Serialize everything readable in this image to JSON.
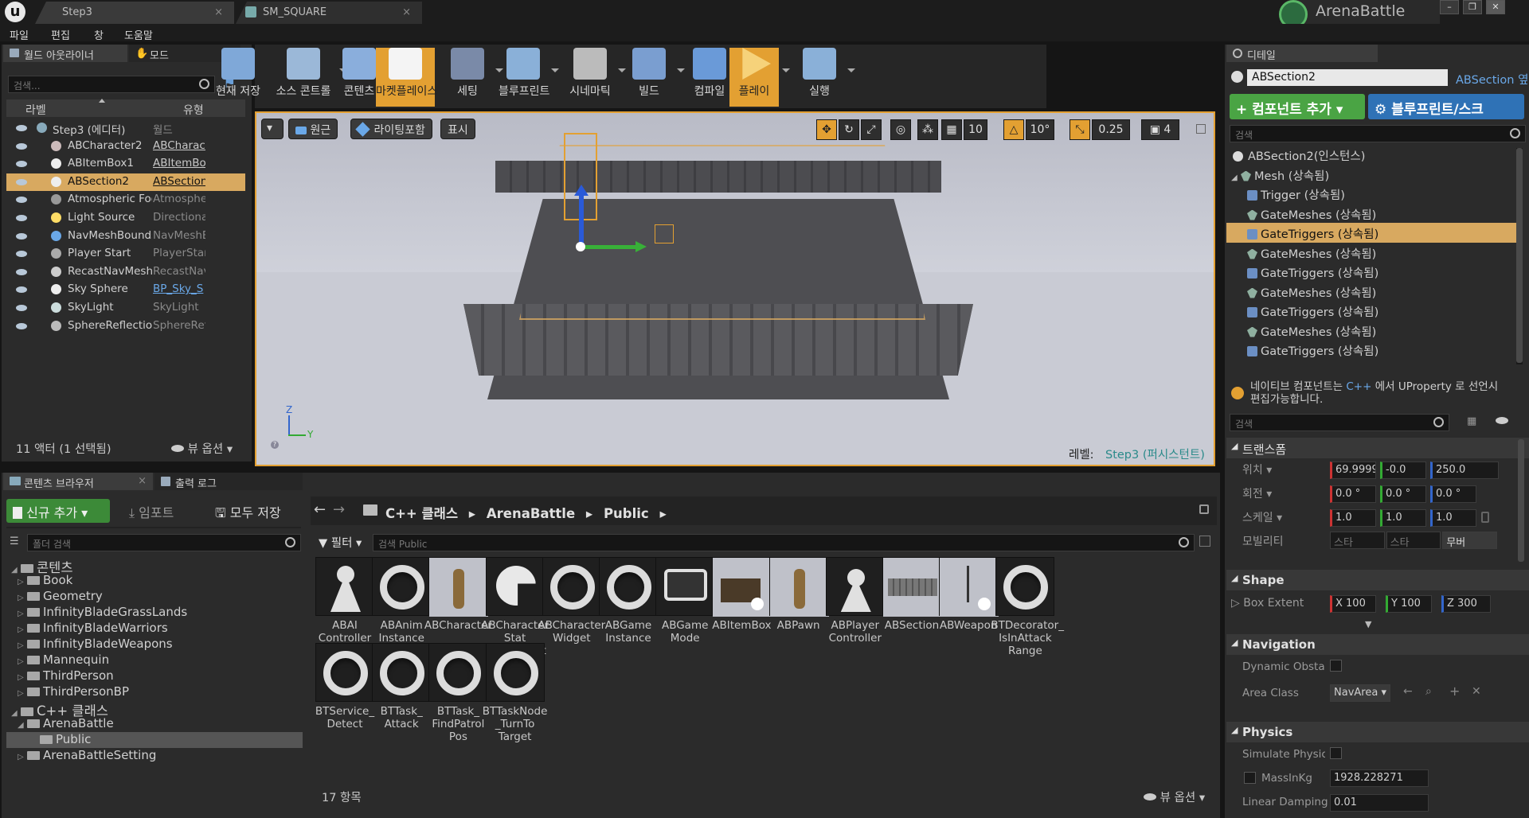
{
  "titlebar": {
    "tabs": [
      {
        "label": "Step3"
      },
      {
        "label": "SM_SQUARE"
      }
    ],
    "project_name": "ArenaBattle",
    "window_buttons": [
      "minimize-icon",
      "restore-icon",
      "close-icon"
    ]
  },
  "menu": {
    "items": [
      "파일",
      "편집",
      "창",
      "도움말"
    ]
  },
  "outliner": {
    "tabs": [
      "월드 아웃라이너",
      "모드"
    ],
    "search_placeholder": "검색...",
    "col_label": "라벨",
    "col_type": "유형",
    "rows": [
      {
        "label": "Step3 (에디터)",
        "type": "월드"
      },
      {
        "label": "ABCharacter2",
        "type": "ABCharact"
      },
      {
        "label": "ABItemBox1",
        "type": "ABItemBox"
      },
      {
        "label": "ABSection2",
        "type": "ABSection"
      },
      {
        "label": "Atmospheric Fog",
        "type": "Atmospheri"
      },
      {
        "label": "Light Source",
        "type": "Directionall"
      },
      {
        "label": "NavMeshBoundsVo",
        "type": "NavMeshB"
      },
      {
        "label": "Player Start",
        "type": "PlayerStart"
      },
      {
        "label": "RecastNavMesh-De",
        "type": "RecastNavl"
      },
      {
        "label": "Sky Sphere",
        "type": "BP_Sky_S"
      },
      {
        "label": "SkyLight",
        "type": "SkyLight"
      },
      {
        "label": "SphereReflectionCa",
        "type": "SphereRefle"
      }
    ],
    "footer_count": "11 액터 (1 선택됨)",
    "view_options": "뷰 옵션"
  },
  "toolbar": {
    "buttons": [
      "현재 저장",
      "소스 콘트롤",
      "콘텐츠",
      "마켓플레이스",
      "세팅",
      "블루프린트",
      "시네마틱",
      "빌드",
      "컴파일",
      "플레이",
      "실행"
    ]
  },
  "viewport": {
    "perspective": "원근",
    "lighting": "라이팅포함",
    "show": "표시",
    "grid_snap": "10",
    "rot_snap": "10°",
    "scale_snap": "0.25",
    "camera_speed": "4",
    "level_label": "레벨:",
    "level_name": "Step3 (퍼시스턴트)",
    "axis_z": "Z",
    "axis_y": "Y"
  },
  "content_browser": {
    "tabs": [
      "콘텐츠 브라우저",
      "출력 로그"
    ],
    "add_new": "신규 추가",
    "import": "임포트",
    "save_all": "모두 저장",
    "folder_search_placeholder": "폴더 검색",
    "breadcrumb": [
      "C++ 클래스",
      "ArenaBattle",
      "Public"
    ],
    "filter": "필터",
    "asset_search_placeholder": "검색 Public",
    "tree": [
      {
        "label": "콘텐츠",
        "level": 0
      },
      {
        "label": "Book",
        "level": 1
      },
      {
        "label": "Geometry",
        "level": 1
      },
      {
        "label": "InfinityBladeGrassLands",
        "level": 1
      },
      {
        "label": "InfinityBladeWarriors",
        "level": 1
      },
      {
        "label": "InfinityBladeWeapons",
        "level": 1
      },
      {
        "label": "Mannequin",
        "level": 1
      },
      {
        "label": "ThirdPerson",
        "level": 1
      },
      {
        "label": "ThirdPersonBP",
        "level": 1
      },
      {
        "label": "C++ 클래스",
        "level": 0
      },
      {
        "label": "ArenaBattle",
        "level": 1
      },
      {
        "label": "Public",
        "level": 2
      },
      {
        "label": "ArenaBattleSetting",
        "level": 1
      }
    ],
    "assets": [
      {
        "label": "ABAI Controller",
        "thumb": "pawn"
      },
      {
        "label": "ABAnim Instance",
        "thumb": "ring"
      },
      {
        "label": "ABCharacter",
        "thumb": "warrior"
      },
      {
        "label": "ABCharacter Stat Component",
        "thumb": "sphere"
      },
      {
        "label": "ABCharacter Widget",
        "thumb": "ring"
      },
      {
        "label": "ABGame Instance",
        "thumb": "ring"
      },
      {
        "label": "ABGame Mode",
        "thumb": "gamepad"
      },
      {
        "label": "ABItemBox",
        "thumb": "chest"
      },
      {
        "label": "ABPawn",
        "thumb": "warrior"
      },
      {
        "label": "ABPlayer Controller",
        "thumb": "player"
      },
      {
        "label": "ABSection",
        "thumb": "section"
      },
      {
        "label": "ABWeapon",
        "thumb": "weapon"
      },
      {
        "label": "BTDecorator_ IsInAttack Range",
        "thumb": "ring"
      },
      {
        "label": "BTService_ Detect",
        "thumb": "ring"
      },
      {
        "label": "BTTask_ Attack",
        "thumb": "ring"
      },
      {
        "label": "BTTask_ FindPatrol Pos",
        "thumb": "ring"
      },
      {
        "label": "BTTaskNode _TurnTo Target",
        "thumb": "ring"
      }
    ],
    "item_count": "17 항목",
    "view_options": "뷰 옵션"
  },
  "details": {
    "tab": "디테일",
    "actor_name": "ABSection2",
    "class_link": "ABSection 옆",
    "add_component": "컴포넌트 추가",
    "blueprint": "블루프린트/스크",
    "search_placeholder": "검색",
    "components": [
      {
        "label": "ABSection2(인스턴스)",
        "icon": "instance",
        "indent": 0
      },
      {
        "label": "Mesh (상속됨)",
        "icon": "mesh",
        "indent": 1
      },
      {
        "label": "Trigger (상속됨)",
        "icon": "cube",
        "indent": 2
      },
      {
        "label": "GateMeshes (상속됨)",
        "icon": "mesh",
        "indent": 2
      },
      {
        "label": "GateTriggers (상속됨)",
        "icon": "cube",
        "indent": 2
      },
      {
        "label": "GateMeshes (상속됨)",
        "icon": "mesh",
        "indent": 2
      },
      {
        "label": "GateTriggers (상속됨)",
        "icon": "cube",
        "indent": 2
      },
      {
        "label": "GateMeshes (상속됨)",
        "icon": "mesh",
        "indent": 2
      },
      {
        "label": "GateTriggers (상속됨)",
        "icon": "cube",
        "indent": 2
      },
      {
        "label": "GateMeshes (상속됨)",
        "icon": "mesh",
        "indent": 2
      },
      {
        "label": "GateTriggers (상속됨)",
        "icon": "cube",
        "indent": 2
      }
    ],
    "native_note_1": "네이티브 컴포넌트는",
    "native_note_link": "C++",
    "native_note_2": "에서 UProperty 로 선언시",
    "native_note_3": "편집가능합니다.",
    "search2_placeholder": "검색",
    "transform": {
      "title": "트랜스폼",
      "location_label": "위치",
      "location": [
        "69.9999",
        "-0.0",
        "250.0"
      ],
      "rotation_label": "회전",
      "rotation": [
        "0.0 °",
        "0.0 °",
        "0.0 °"
      ],
      "scale_label": "스케일",
      "scale": [
        "1.0",
        "1.0",
        "1.0"
      ],
      "mobility_label": "모빌리티",
      "mobility": [
        "스타",
        "스타",
        "무버"
      ]
    },
    "shape": {
      "title": "Shape",
      "box_extent_label": "Box Extent",
      "box_extent": [
        "X 100",
        "Y 100",
        "Z 300"
      ]
    },
    "navigation": {
      "title": "Navigation",
      "dynamic_obstacle_label": "Dynamic Obstac",
      "area_class_label": "Area Class",
      "area_class_value": "NavArea"
    },
    "physics": {
      "title": "Physics",
      "simulate_label": "Simulate Physic",
      "mass_label": "MassInKg",
      "mass_value": "1928.228271",
      "linear_damping_label": "Linear Damping",
      "linear_damping_value": "0.01"
    }
  },
  "colors": {
    "accent_orange": "#e3a032",
    "add_green": "#4aa444",
    "blueprint_blue": "#2f72b6",
    "selection": "#d8a960"
  }
}
